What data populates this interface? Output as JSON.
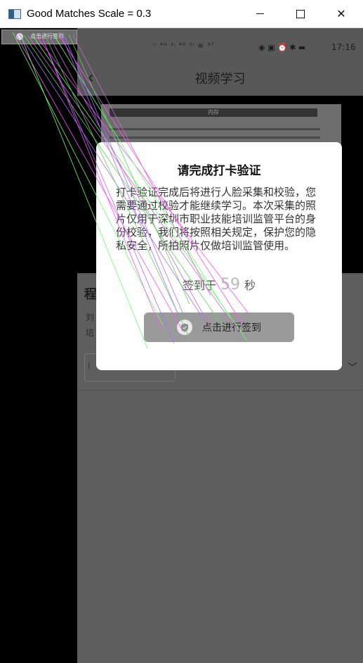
{
  "window": {
    "title": "Good Matches Scale = 0.3",
    "min_glyph": "",
    "close_glyph": "✕"
  },
  "thumbnail": {
    "text": "点击进行签到"
  },
  "phone": {
    "status_left": "ᵎᵎ ⁴ᴳ ᵃᵎ ⁴ᴳ ᵃᵎ ≋ ³⁷",
    "status_time": "17:16",
    "back_glyph": "‹",
    "page_title": "视频学习",
    "doc_header": "内存",
    "course_title": "程",
    "course_line1": "刘",
    "course_line2": "培",
    "course_tab": "(",
    "chevron": "﹀"
  },
  "modal": {
    "title": "请完成打卡验证",
    "body": "打卡验证完成后将进行人脸采集和校验，您需要通过校验才能继续学习。本次采集的照片仅用于深圳市职业技能培训监管平台的身份校验，我们将按照相关规定，保护您的隐私安全，所拍照片仅做培训监管使用。",
    "countdown_prefix": "签到于",
    "countdown_value": "59",
    "countdown_suffix": "秒",
    "sign_button_label": "点击进行签到",
    "sign_icon": "shield-check-icon"
  },
  "colors": {
    "overlay_gray": "#585858",
    "button_gray": "#9a9a9a",
    "match_colors": [
      "#6cff6c",
      "#ff4fff",
      "#b06bff",
      "#5fd35f",
      "#c86bc8"
    ]
  }
}
